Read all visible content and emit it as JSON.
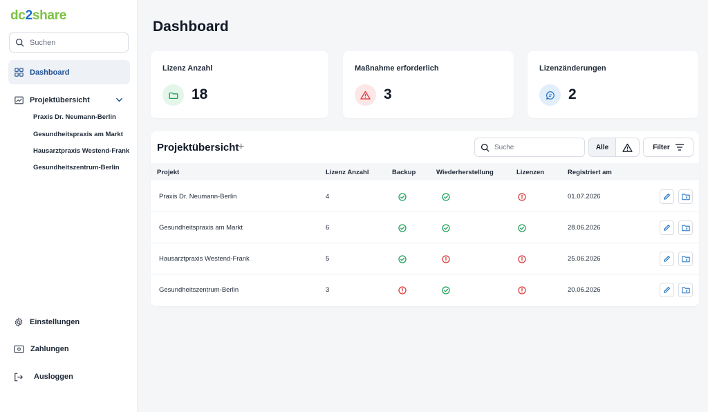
{
  "logo": {
    "part1": "dc",
    "part2": "2",
    "part3": "share"
  },
  "sidebar": {
    "search_placeholder": "Suchen",
    "nav_active": "Dashboard",
    "projects_label": "Projektübersicht",
    "projects": [
      "Praxis Dr. Neumann-Berlin",
      "Gesundheitspraxis am Markt",
      "Hausarztpraxis Westend-Frank",
      "Gesundheitszentrum-Berlin"
    ],
    "bottom": [
      "Einstellungen",
      "Zahlungen",
      "Ausloggen"
    ]
  },
  "page_title": "Dashboard",
  "cards": [
    {
      "title": "Lizenz Anzahl",
      "value": "18",
      "icon": "folder-icon",
      "color": "#22a05b",
      "bg": "#e3f6e9"
    },
    {
      "title": "Maßnahme erforderlich",
      "value": "3",
      "icon": "warning-icon",
      "color": "#dc3b3b",
      "bg": "#fde6e6"
    },
    {
      "title": "Lizenzänderungen",
      "value": "2",
      "icon": "chat-icon",
      "color": "#1d6fc4",
      "bg": "#e3eefb"
    }
  ],
  "table": {
    "title": "Projektübersicht",
    "add": "+",
    "search_placeholder": "Suche",
    "seg_all": "Alle",
    "filter_label": "Filter",
    "columns": [
      "Projekt",
      "Lizenz Anzahl",
      "Backup",
      "Wiederherstellung",
      "Lizenzen",
      "Registriert am"
    ],
    "rows": [
      {
        "project": "Praxis Dr. Neumann-Berlin",
        "licenses": "4",
        "backup": "ok",
        "restore": "ok",
        "lizenzen": "error",
        "date": "01.07.2026"
      },
      {
        "project": "Gesundheitspraxis am Markt",
        "licenses": "6",
        "backup": "ok",
        "restore": "ok",
        "lizenzen": "ok",
        "date": "28.06.2026"
      },
      {
        "project": "Hausarztpraxis Westend-Frank",
        "licenses": "5",
        "backup": "ok",
        "restore": "error",
        "lizenzen": "error",
        "date": "25.06.2026"
      },
      {
        "project": "Gesundheitszentrum-Berlin",
        "licenses": "3",
        "backup": "error",
        "restore": "ok",
        "lizenzen": "error",
        "date": "20.06.2026"
      }
    ]
  },
  "colors": {
    "ok": "#22a05b",
    "error": "#dc3b3b",
    "accent": "#1d6fc4"
  }
}
